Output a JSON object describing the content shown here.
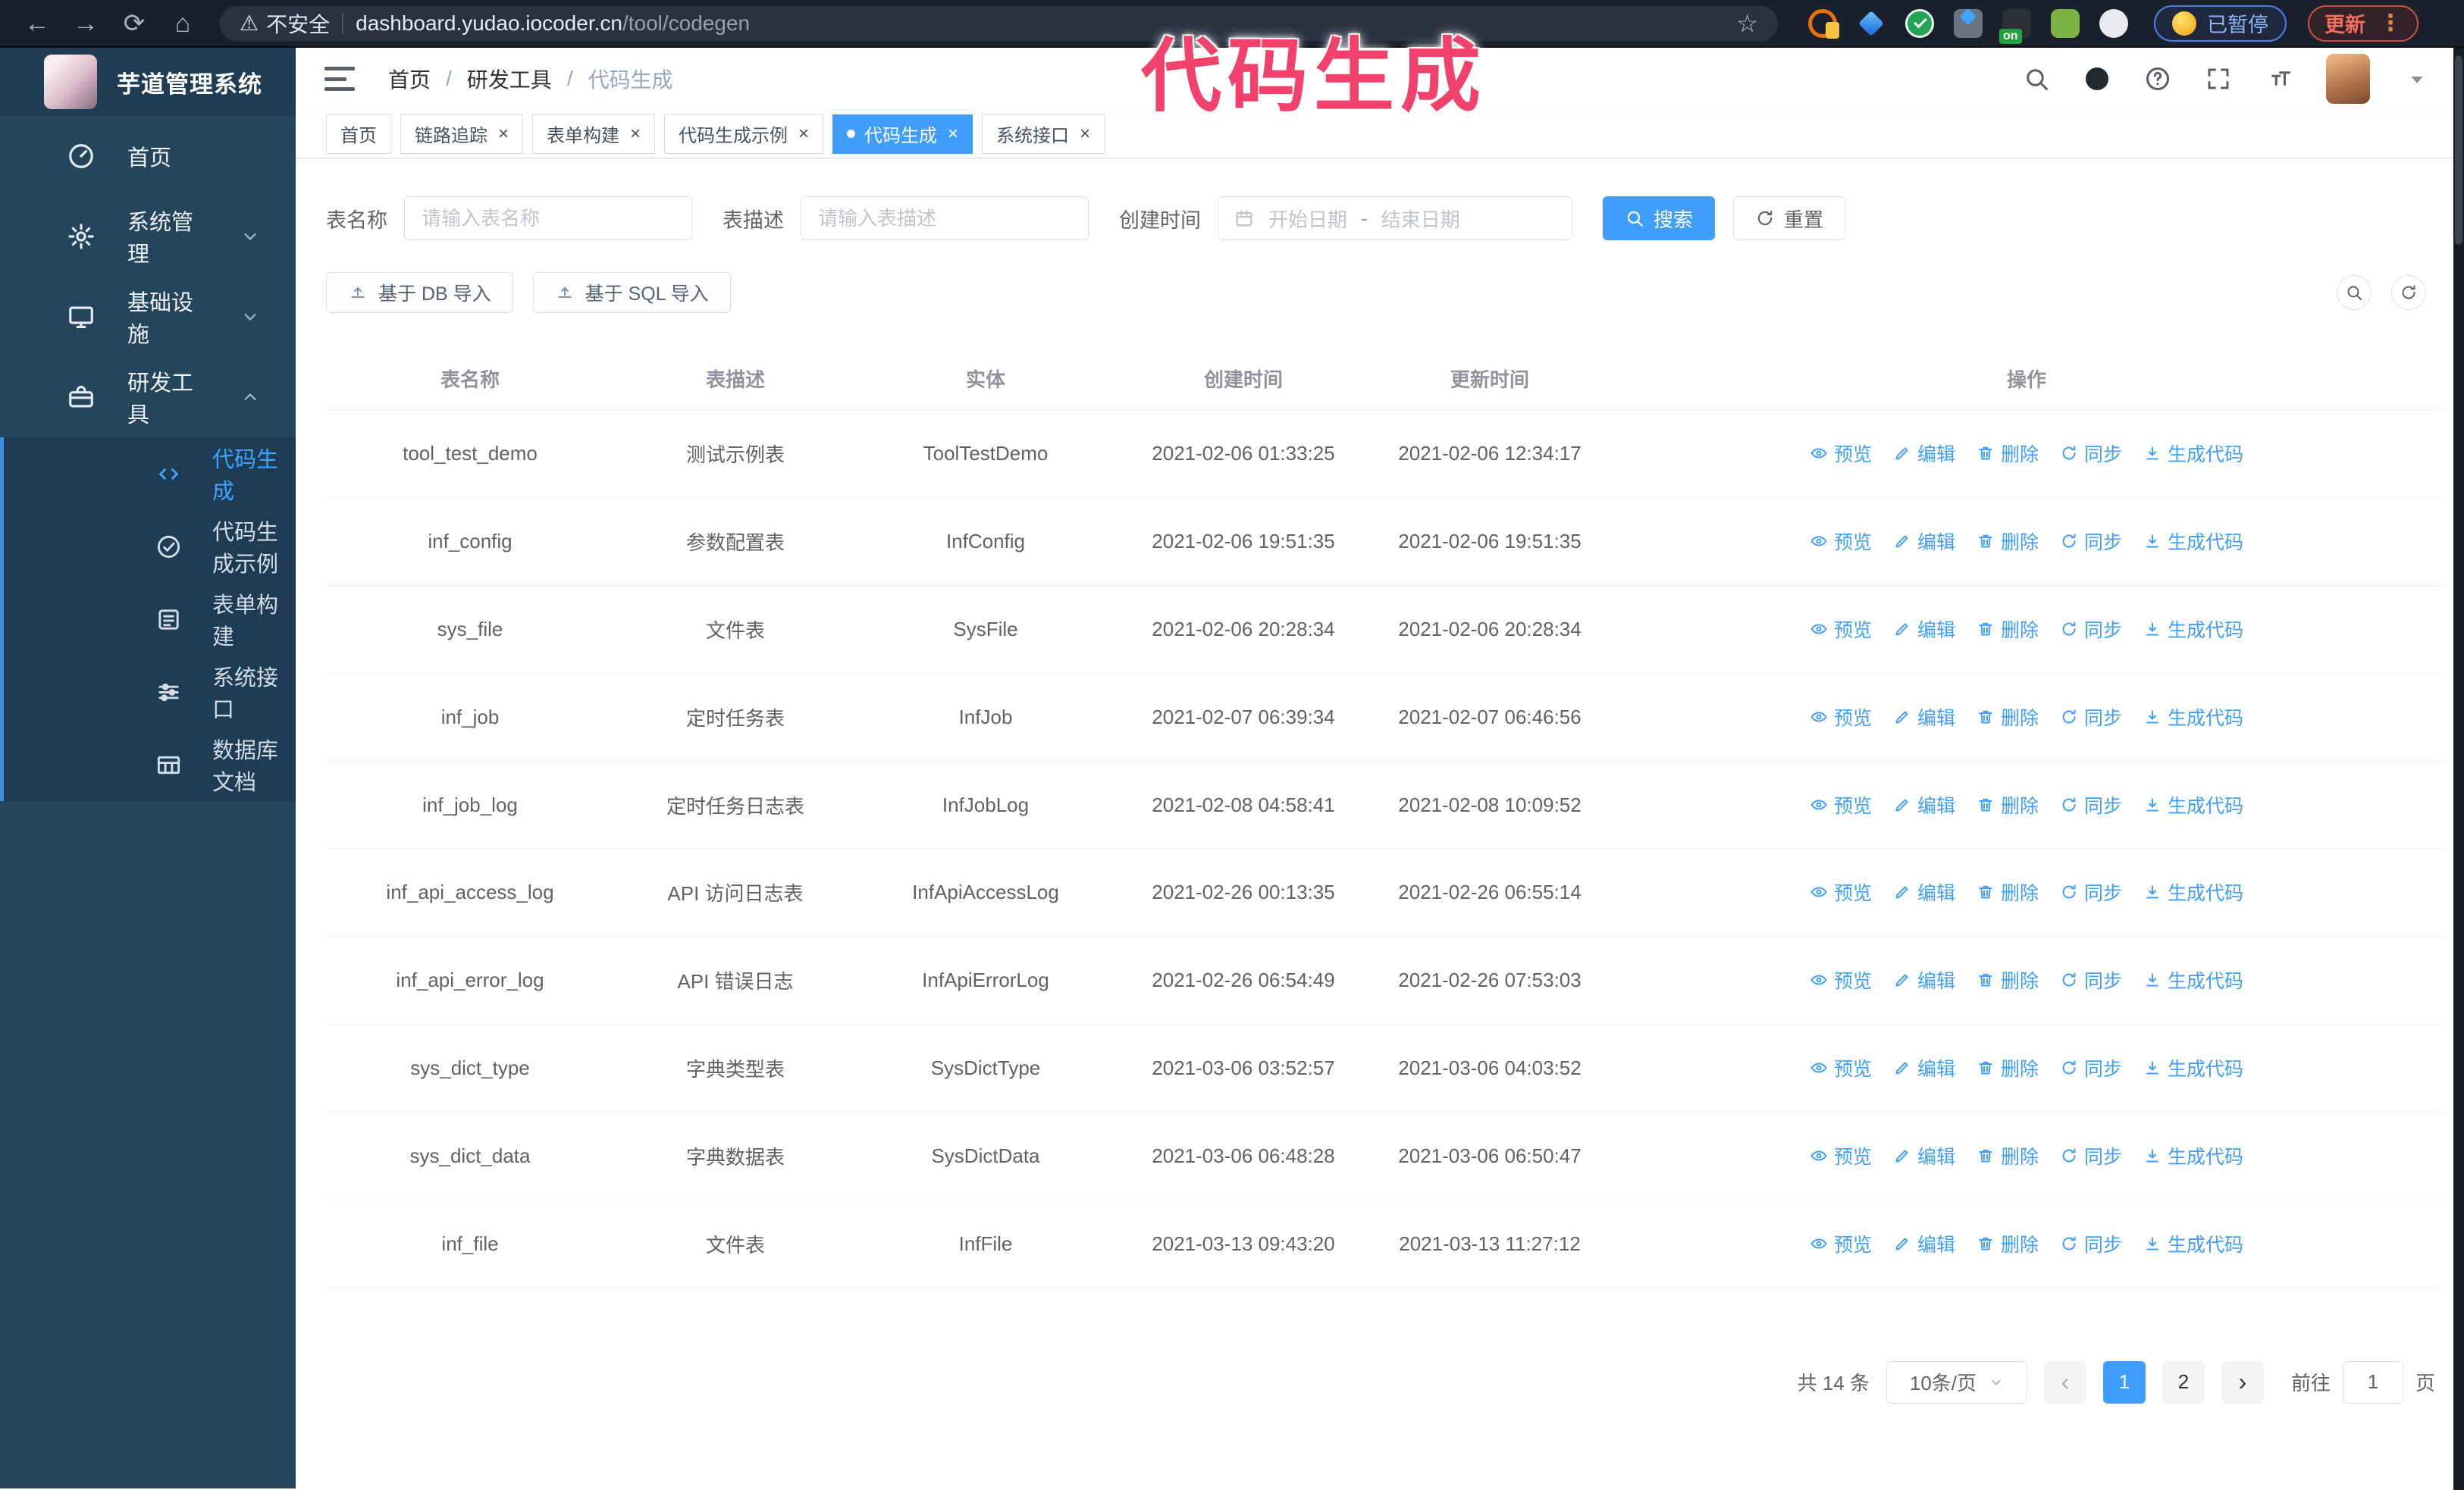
{
  "browser": {
    "security_warning": "不安全",
    "url_domain": "dashboard.yudao.iocoder.cn",
    "url_path": "/tool/codegen",
    "ext_on_badge": "on",
    "paused_label": "已暂停",
    "update_label": "更新"
  },
  "overlay_annotation": "代码生成",
  "sidebar": {
    "app_title": "芋道管理系统",
    "menu": [
      {
        "label": "首页",
        "icon": "dashboard-icon"
      },
      {
        "label": "系统管理",
        "icon": "gear-icon",
        "chevron": "down"
      },
      {
        "label": "基础设施",
        "icon": "monitor-icon",
        "chevron": "down"
      },
      {
        "label": "研发工具",
        "icon": "toolbox-icon",
        "chevron": "up",
        "children": [
          {
            "label": "代码生成",
            "icon": "code-icon",
            "active": true
          },
          {
            "label": "代码生成示例",
            "icon": "example-icon"
          },
          {
            "label": "表单构建",
            "icon": "form-icon"
          },
          {
            "label": "系统接口",
            "icon": "sliders-icon"
          },
          {
            "label": "数据库文档",
            "icon": "table-icon"
          }
        ]
      }
    ]
  },
  "breadcrumb": [
    "首页",
    "研发工具",
    "代码生成"
  ],
  "tabs": [
    {
      "label": "首页",
      "closable": false,
      "active": false
    },
    {
      "label": "链路追踪",
      "closable": true,
      "active": false
    },
    {
      "label": "表单构建",
      "closable": true,
      "active": false
    },
    {
      "label": "代码生成示例",
      "closable": true,
      "active": false
    },
    {
      "label": "代码生成",
      "closable": true,
      "active": true
    },
    {
      "label": "系统接口",
      "closable": true,
      "active": false
    }
  ],
  "filters": {
    "name_label": "表名称",
    "name_placeholder": "请输入表名称",
    "desc_label": "表描述",
    "desc_placeholder": "请输入表描述",
    "time_label": "创建时间",
    "start_placeholder": "开始日期",
    "range_separator": "-",
    "end_placeholder": "结束日期",
    "search_label": "搜索",
    "reset_label": "重置"
  },
  "toolbar": {
    "import_db_label": "基于 DB 导入",
    "import_sql_label": "基于 SQL 导入"
  },
  "table": {
    "columns": [
      "表名称",
      "表描述",
      "实体",
      "创建时间",
      "更新时间",
      "操作"
    ],
    "row_actions": [
      {
        "label": "预览",
        "icon": "eye-icon"
      },
      {
        "label": "编辑",
        "icon": "pencil-icon"
      },
      {
        "label": "删除",
        "icon": "trash-icon"
      },
      {
        "label": "同步",
        "icon": "sync-icon"
      },
      {
        "label": "生成代码",
        "icon": "download-icon"
      }
    ],
    "rows": [
      {
        "name": "tool_test_demo",
        "desc": "测试示例表",
        "entity": "ToolTestDemo",
        "created": "2021-02-06 01:33:25",
        "updated": "2021-02-06 12:34:17"
      },
      {
        "name": "inf_config",
        "desc": "参数配置表",
        "entity": "InfConfig",
        "created": "2021-02-06 19:51:35",
        "updated": "2021-02-06 19:51:35"
      },
      {
        "name": "sys_file",
        "desc": "文件表",
        "entity": "SysFile",
        "created": "2021-02-06 20:28:34",
        "updated": "2021-02-06 20:28:34"
      },
      {
        "name": "inf_job",
        "desc": "定时任务表",
        "entity": "InfJob",
        "created": "2021-02-07 06:39:34",
        "updated": "2021-02-07 06:46:56"
      },
      {
        "name": "inf_job_log",
        "desc": "定时任务日志表",
        "entity": "InfJobLog",
        "created": "2021-02-08 04:58:41",
        "updated": "2021-02-08 10:09:52"
      },
      {
        "name": "inf_api_access_log",
        "desc": "API 访问日志表",
        "entity": "InfApiAccessLog",
        "created": "2021-02-26 00:13:35",
        "updated": "2021-02-26 06:55:14"
      },
      {
        "name": "inf_api_error_log",
        "desc": "API 错误日志",
        "entity": "InfApiErrorLog",
        "created": "2021-02-26 06:54:49",
        "updated": "2021-02-26 07:53:03"
      },
      {
        "name": "sys_dict_type",
        "desc": "字典类型表",
        "entity": "SysDictType",
        "created": "2021-03-06 03:52:57",
        "updated": "2021-03-06 04:03:52"
      },
      {
        "name": "sys_dict_data",
        "desc": "字典数据表",
        "entity": "SysDictData",
        "created": "2021-03-06 06:48:28",
        "updated": "2021-03-06 06:50:47"
      },
      {
        "name": "inf_file",
        "desc": "文件表",
        "entity": "InfFile",
        "created": "2021-03-13 09:43:20",
        "updated": "2021-03-13 11:27:12"
      }
    ]
  },
  "pagination": {
    "total_label": "共 14 条",
    "page_size_label": "10条/页",
    "pages": [
      "1",
      "2"
    ],
    "active_page": "1",
    "goto_label": "前往",
    "goto_value": "1",
    "page_unit": "页"
  },
  "colors": {
    "accent": "#409EFF",
    "sidebar_bg": "#24455C",
    "submenu_bg": "#1E3C54",
    "annotation_pink": "#F2416B"
  }
}
